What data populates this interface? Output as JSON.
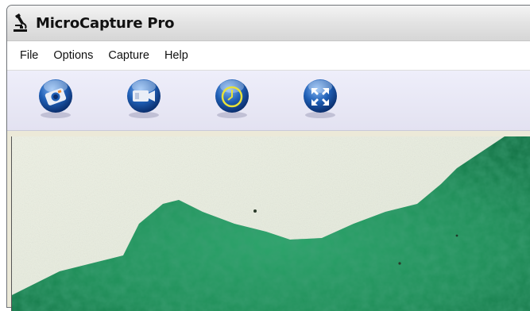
{
  "window": {
    "title": "MicroCapture Pro",
    "icon": "microscope-icon"
  },
  "menu": [
    "File",
    "Options",
    "Capture",
    "Help"
  ],
  "toolbar": [
    {
      "name": "camera-button",
      "icon": "camera-icon"
    },
    {
      "name": "video-button",
      "icon": "video-camera-icon"
    },
    {
      "name": "timer-button",
      "icon": "clock-icon"
    },
    {
      "name": "fullscreen-button",
      "icon": "expand-arrows-icon"
    }
  ],
  "colors": {
    "button_blue": "#1f5fb5",
    "timer_ring": "#e8e23a",
    "specimen_green": "#1d8e57"
  }
}
